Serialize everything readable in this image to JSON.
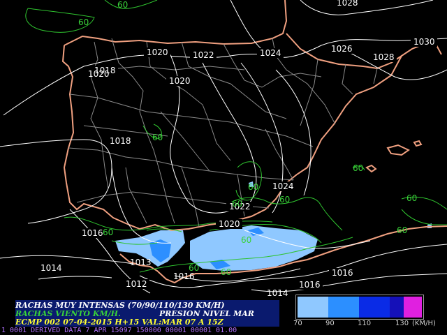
{
  "map": {
    "isobar_labels": [
      "1028",
      "1030",
      "1020",
      "1022",
      "1024",
      "1026",
      "1028",
      "1018",
      "1020",
      "1018",
      "1024",
      "1022",
      "1020",
      "1016",
      "1013",
      "1014",
      "1012",
      "1016",
      "1016",
      "1016",
      "1014",
      "1020"
    ],
    "gust_labels": [
      "60",
      "60",
      "60",
      "60",
      "60",
      "60",
      "60",
      "60",
      "60",
      "60",
      "60",
      "60",
      "60"
    ]
  },
  "header": {
    "line1": "RACHAS MUY INTENSAS (70/90/110/130 KM/H)",
    "line2_left": "RACHAS VIENTO KM/H.",
    "line2_right": "PRESION NIVEL MAR",
    "line3": "ECMP 002 07-04-2015 H+15 VAL:MAR 07 A 15Z"
  },
  "legend": {
    "ticks": [
      "70",
      "90",
      "110",
      "130"
    ],
    "unit": "(KM/H)",
    "colors": [
      "#8fc8ff",
      "#2c8fff",
      "#0a2be6",
      "#1510b8",
      "#e020e0"
    ]
  },
  "footer": {
    "text": "1 0001 DERIVED DATA  7 APR 15097 150000 00001 00001 01.00"
  },
  "colors": {
    "coast": "#f0a080",
    "borders": "#8a8a8a",
    "isobars": "#ffffff",
    "gust_contours": "#2fc32f",
    "hdr_line1": "#ffffff",
    "hdr_line2": "#39d339",
    "hdr_line3": "#ffff30"
  }
}
